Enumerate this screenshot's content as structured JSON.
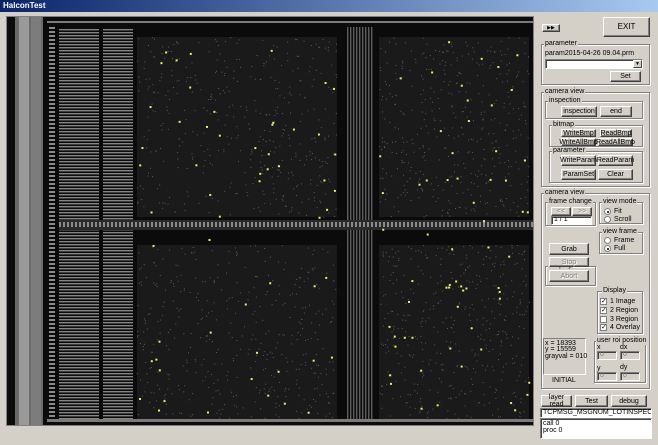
{
  "window": {
    "title": "HalconTest"
  },
  "top": {
    "small_button": "▶▶",
    "exit_label": "EXIT"
  },
  "parameter": {
    "group_label": "parameter",
    "file_name": "param2015-04-26 09.04.prm",
    "combo_value": "",
    "set_label": "Set"
  },
  "camera_view1": {
    "group_label": "camera view",
    "inspection": {
      "group_label": "inspection",
      "inspection_label": "inspection",
      "end_label": "end"
    },
    "bitmap": {
      "group_label": "bitmap",
      "write_bmp": "WriteBmp",
      "read_bmp": "ReadBmp",
      "write_all_bmp": "WriteAllBmp",
      "read_all_bmp": "ReadAllBmp"
    },
    "parameter": {
      "group_label": "parameter",
      "write_param": "WriteParam",
      "read_param": "ReadParam",
      "param_set": "ParamSet",
      "clear": "Clear"
    }
  },
  "camera_view2": {
    "group_label": "camera view",
    "frame_change": {
      "group_label": "frame change",
      "prev": "<<",
      "next": ">>",
      "value": "1 / 1"
    },
    "view_mode": {
      "group_label": "view mode",
      "options": [
        "Fit",
        "Scroll"
      ],
      "selected": 0
    },
    "view_frame": {
      "group_label": "view frame",
      "options": [
        "Frame",
        "Full"
      ],
      "selected": 1
    },
    "display": {
      "group_label": "Display",
      "grab": "Grab",
      "stop": "Stop",
      "abort": "Abort"
    },
    "display2": {
      "group_label": "Display",
      "items": [
        "1 Image",
        "2 Region",
        "3 Region",
        "4 Overlay"
      ],
      "checked": [
        true,
        true,
        false,
        true
      ]
    },
    "info": {
      "x": "x = 18393",
      "y": "y = 15559",
      "grayval": "grayval = 010",
      "status": "INITIAL"
    },
    "user_roi": {
      "group_label": "user roi position",
      "x_label": "x",
      "dx_label": "dx",
      "y_label": "y",
      "dy_label": "dy",
      "x": "0",
      "dx": "0",
      "y": "0",
      "dy": "0"
    }
  },
  "bottom": {
    "layer_read": "layer read",
    "test": "Test",
    "debug": "debug",
    "message": "TCPMSG_MSGNUM_LOTINSPECSTAR",
    "log": [
      "call 0",
      "proc 0"
    ]
  },
  "colors": {
    "title_start": "#0a246a",
    "title_end": "#a6caf0",
    "face": "#d4d0c8",
    "defect": "#e8f060"
  }
}
